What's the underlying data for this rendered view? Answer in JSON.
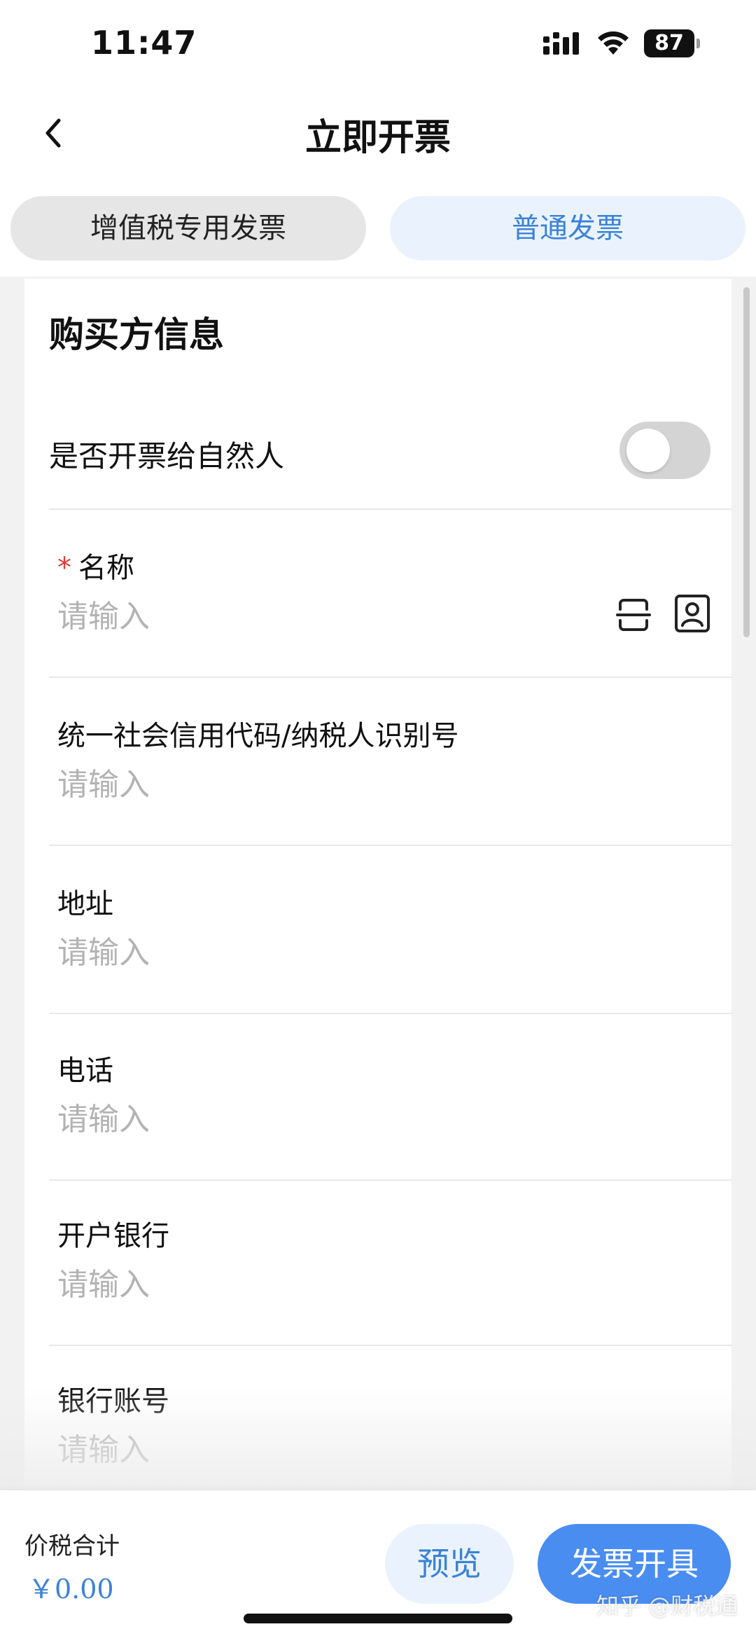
{
  "status_bar": {
    "time": "11:47",
    "battery": "87"
  },
  "nav": {
    "title": "立即开票"
  },
  "tabs": [
    {
      "label": "增值税专用发票",
      "selected": false
    },
    {
      "label": "普通发票",
      "selected": true
    }
  ],
  "buyer_section": {
    "title": "购买方信息",
    "natural_person_toggle": {
      "label": "是否开票给自然人",
      "on": false
    },
    "fields": [
      {
        "label": "名称",
        "required": true,
        "placeholder": "请输入",
        "value": ""
      },
      {
        "label": "统一社会信用代码/纳税人识别号",
        "required": false,
        "placeholder": "请输入",
        "value": ""
      },
      {
        "label": "地址",
        "required": false,
        "placeholder": "请输入",
        "value": ""
      },
      {
        "label": "电话",
        "required": false,
        "placeholder": "请输入",
        "value": ""
      },
      {
        "label": "开户银行",
        "required": false,
        "placeholder": "请输入",
        "value": ""
      },
      {
        "label": "银行账号",
        "required": false,
        "placeholder": "请输入",
        "value": ""
      }
    ],
    "required_mark": "*"
  },
  "footer": {
    "total_label": "价税合计",
    "total_value": "￥0.00",
    "preview_label": "预览",
    "issue_label": "发票开具",
    "watermark": "知乎 @财税通"
  },
  "icons": {
    "back": "chevron-left-icon",
    "scan": "scan-icon",
    "contact": "contact-icon",
    "signal": "cellular-signal-icon",
    "wifi": "wifi-icon",
    "battery": "battery-icon"
  },
  "colors": {
    "accent": "#3b82d6",
    "primary_button": "#4a8df0",
    "selected_tab_bg": "#eaf3fd",
    "unselected_tab_bg": "#e6e6e6",
    "required": "#e03a3a",
    "placeholder": "#b3b3b3"
  }
}
